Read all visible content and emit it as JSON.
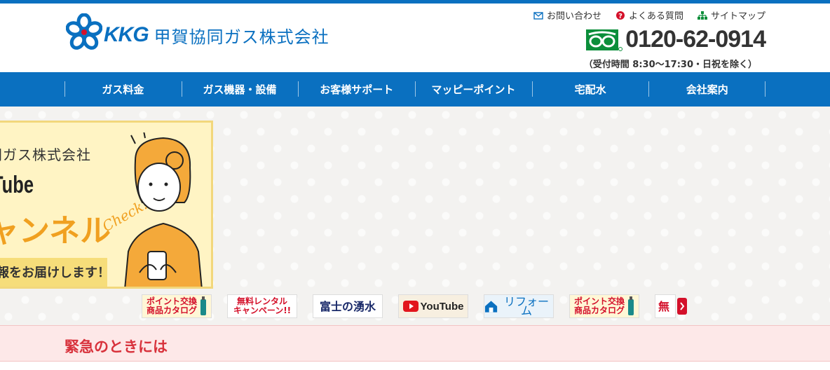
{
  "header": {
    "logo_mark": "KKG",
    "company_name": "甲賀協同ガス株式会社",
    "utility_links": [
      {
        "label": "お問い合わせ",
        "icon": "mail-icon"
      },
      {
        "label": "よくある質問",
        "icon": "question-icon"
      },
      {
        "label": "サイトマップ",
        "icon": "sitemap-icon"
      }
    ],
    "phone_number": "0120-62-0914",
    "phone_hours": "（受付時間 8:30〜17:30・日祝を除く）"
  },
  "nav": {
    "items": [
      "ガス料金",
      "ガス機器・設備",
      "お客様サポート",
      "マッピーポイント",
      "宅配水",
      "会社案内"
    ]
  },
  "hero": {
    "banner": {
      "line1": "同ガス株式会社",
      "line2": "Tube",
      "line3": "ャンネル",
      "line4": "報をお届けします！",
      "check_text": "Check!"
    },
    "thumbnails": [
      {
        "text": "ポイント交換\n商品カタログ",
        "color": "#d4102a"
      },
      {
        "text": "無料レンタル\nキャンペーン!!",
        "color": "#d4102a"
      },
      {
        "text": "富士の湧水",
        "color": "#1a2a6a"
      },
      {
        "text": "YouTube",
        "color": "#222222"
      },
      {
        "text": "リフォーム",
        "color": "#0a70c0"
      },
      {
        "text": "ポイント交換\n商品カタログ",
        "color": "#d4102a"
      },
      {
        "text": "無",
        "color": "#d4102a"
      }
    ]
  },
  "emergency": {
    "title": "緊急のときには"
  },
  "colors": {
    "brand_blue": "#0a70c0",
    "phone_green": "#0b8e3a",
    "emergency_red": "#d8323c",
    "banner_yellow": "#fff4c4"
  }
}
